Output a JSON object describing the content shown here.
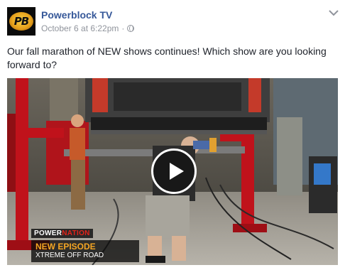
{
  "post": {
    "page_name": "Powerblock TV",
    "avatar_text": "PB",
    "timestamp": "October 6 at 6:22pm",
    "separator": "·",
    "privacy_icon": "globe-icon",
    "menu_icon": "chevron-down-icon",
    "message": "Our fall marathon of NEW shows continues! Which show are you looking forward to?"
  },
  "video": {
    "play_icon": "play-icon",
    "lower_third": {
      "brand_left": "POWER",
      "brand_right": "NATION",
      "title": "NEW EPISODE",
      "subtitle": "XTREME OFF ROAD"
    }
  },
  "colors": {
    "link": "#365899",
    "meta": "#90949c",
    "text": "#1d2129",
    "lift_red": "#c0121b",
    "episode_orange": "#f5a623"
  }
}
